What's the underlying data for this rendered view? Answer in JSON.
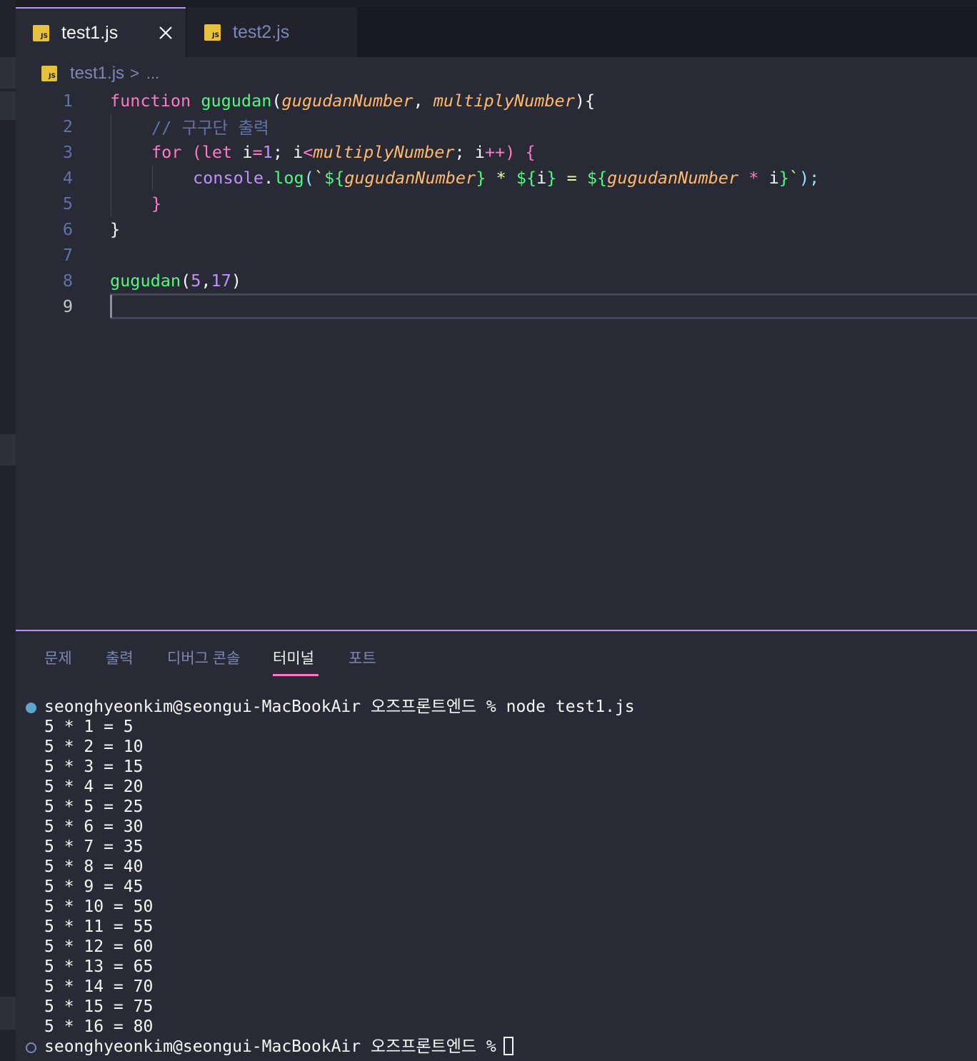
{
  "tabs": [
    {
      "label": "test1.js",
      "icon": "js-file-icon",
      "icon_text": "JS",
      "active": true
    },
    {
      "label": "test2.js",
      "icon": "js-file-icon",
      "icon_text": "JS",
      "active": false
    }
  ],
  "breadcrumb": {
    "file": "test1.js",
    "separator": ">",
    "more": "..."
  },
  "editor": {
    "line_numbers": [
      "1",
      "2",
      "3",
      "4",
      "5",
      "6",
      "7",
      "8",
      "9"
    ],
    "code": {
      "l1": {
        "kw": "function",
        "fn": "gugudan",
        "open": "(",
        "p1": "gugudanNumber",
        "comma": ", ",
        "p2": "multiplyNumber",
        "close": "){"
      },
      "l2": {
        "comment": "// 구구단 출력"
      },
      "l3": {
        "kw_for": "for",
        "paren": " (",
        "kw_let": "let",
        "var": " i",
        "eq": "=",
        "num": "1",
        "semi": "; i",
        "lt": "<",
        "param": "multiplyNumber",
        "semi2": "; i",
        "inc": "++",
        "close": ") {"
      },
      "l4": {
        "obj": "console",
        "dot": ".",
        "method": "log",
        "open": "(",
        "tick": "`",
        "d1": "${",
        "v1": "gugudanNumber",
        "c1": "}",
        "s1": " * ",
        "d2": "${",
        "v2": "i",
        "c2": "}",
        "s2": " = ",
        "d3": "${",
        "v3": "gugudanNumber",
        "mul": " * ",
        "v4": "i",
        "c3": "}",
        "tick2": "`",
        "end": ");"
      },
      "l5": {
        "brace": "}"
      },
      "l6": {
        "brace": "}"
      },
      "l8": {
        "fn": "gugudan",
        "open": "(",
        "n1": "5",
        "comma": ",",
        "n2": "17",
        "close": ")"
      }
    }
  },
  "panel": {
    "tabs": [
      "문제",
      "출력",
      "디버그 콘솔",
      "터미널",
      "포트"
    ],
    "active_tab": "터미널"
  },
  "terminal": {
    "prompt": "seonghyeonkim@seongui-MacBookAir 오즈프론트엔드 %",
    "command": "node test1.js",
    "output": [
      "5 * 1 = 5",
      "5 * 2 = 10",
      "5 * 3 = 15",
      "5 * 4 = 20",
      "5 * 5 = 25",
      "5 * 6 = 30",
      "5 * 7 = 35",
      "5 * 8 = 40",
      "5 * 9 = 45",
      "5 * 10 = 50",
      "5 * 11 = 55",
      "5 * 12 = 60",
      "5 * 13 = 65",
      "5 * 14 = 70",
      "5 * 15 = 75",
      "5 * 16 = 80"
    ],
    "final_prompt": "seonghyeonkim@seongui-MacBookAir 오즈프론트엔드 %"
  },
  "colors": {
    "background": "#282a36",
    "keyword": "#ff79c6",
    "function": "#50fa7b",
    "parameter": "#ffb86c",
    "comment": "#6272a4",
    "number": "#bd93f9",
    "accent": "#bd93f9"
  }
}
